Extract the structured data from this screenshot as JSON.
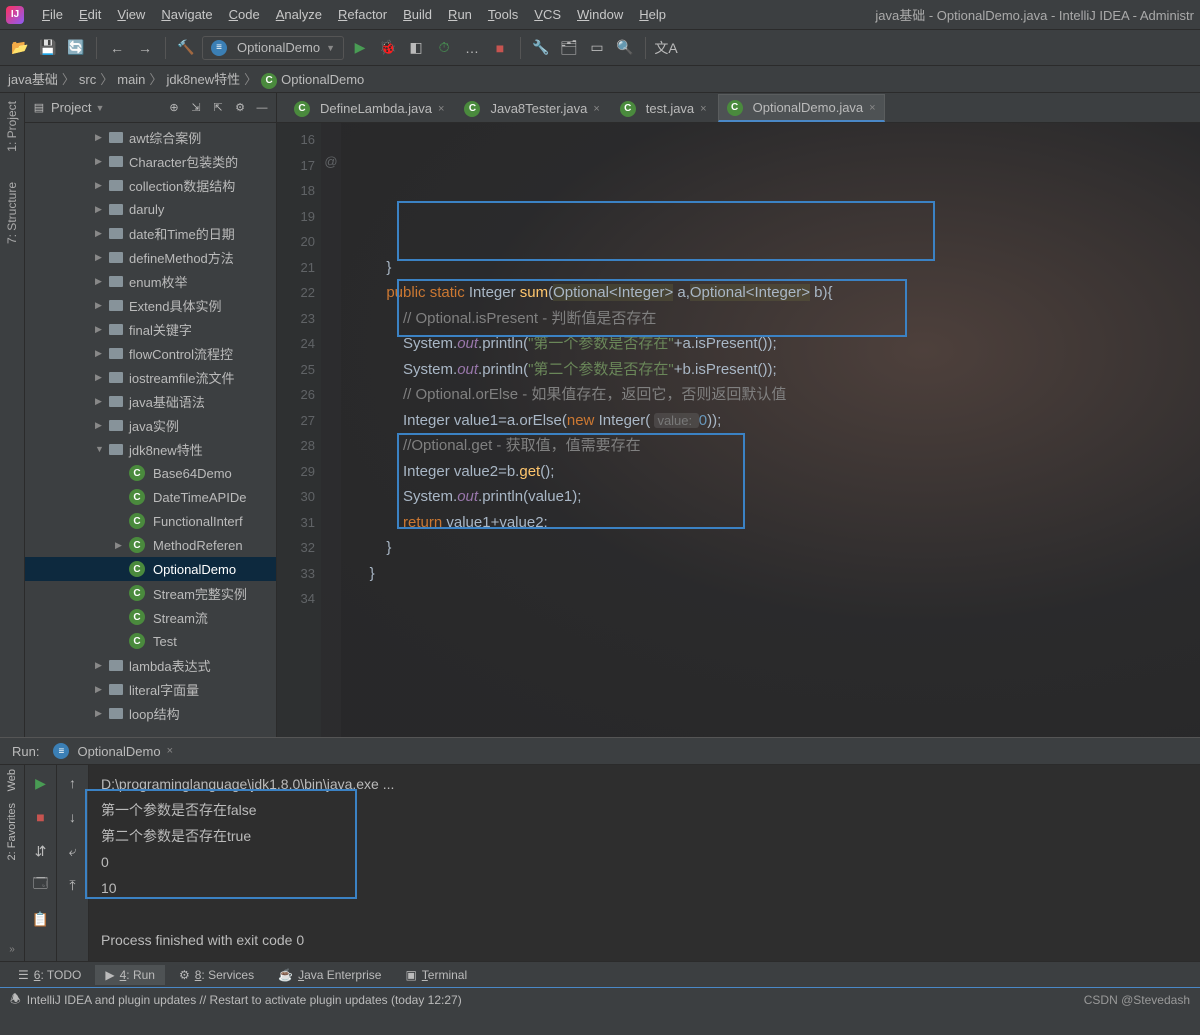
{
  "title": "java基础 - OptionalDemo.java - IntelliJ IDEA - Administr",
  "menus": [
    "File",
    "Edit",
    "View",
    "Navigate",
    "Code",
    "Analyze",
    "Refactor",
    "Build",
    "Run",
    "Tools",
    "VCS",
    "Window",
    "Help"
  ],
  "run_config": "OptionalDemo",
  "breadcrumb": [
    "java基础",
    "src",
    "main",
    "jdk8new特性",
    "OptionalDemo"
  ],
  "project_label": "Project",
  "left_tabs": [
    "1: Project",
    "7: Structure"
  ],
  "tree": [
    {
      "d": 1,
      "a": "▶",
      "i": "f",
      "t": "awt综合案例"
    },
    {
      "d": 1,
      "a": "▶",
      "i": "f",
      "t": "Character包装类的"
    },
    {
      "d": 1,
      "a": "▶",
      "i": "f",
      "t": "collection数据结构"
    },
    {
      "d": 1,
      "a": "▶",
      "i": "f",
      "t": "daruly"
    },
    {
      "d": 1,
      "a": "▶",
      "i": "f",
      "t": "date和Time的日期"
    },
    {
      "d": 1,
      "a": "▶",
      "i": "f",
      "t": "defineMethod方法"
    },
    {
      "d": 1,
      "a": "▶",
      "i": "f",
      "t": "enum枚举"
    },
    {
      "d": 1,
      "a": "▶",
      "i": "f",
      "t": "Extend具体实例"
    },
    {
      "d": 1,
      "a": "▶",
      "i": "f",
      "t": "final关键字"
    },
    {
      "d": 1,
      "a": "▶",
      "i": "f",
      "t": "flowControl流程控"
    },
    {
      "d": 1,
      "a": "▶",
      "i": "f",
      "t": "iostreamfile流文件"
    },
    {
      "d": 1,
      "a": "▶",
      "i": "f",
      "t": "java基础语法"
    },
    {
      "d": 1,
      "a": "▶",
      "i": "f",
      "t": "java实例"
    },
    {
      "d": 1,
      "a": "▼",
      "i": "f",
      "t": "jdk8new特性"
    },
    {
      "d": 2,
      "a": " ",
      "i": "c",
      "t": "Base64Demo"
    },
    {
      "d": 2,
      "a": " ",
      "i": "c",
      "t": "DateTimeAPIDe"
    },
    {
      "d": 2,
      "a": " ",
      "i": "c",
      "t": "FunctionalInterf"
    },
    {
      "d": 2,
      "a": "▶",
      "i": "c",
      "t": "MethodReferen"
    },
    {
      "d": 2,
      "a": " ",
      "i": "c",
      "t": "OptionalDemo",
      "sel": true
    },
    {
      "d": 2,
      "a": " ",
      "i": "c",
      "t": "Stream完整实例"
    },
    {
      "d": 2,
      "a": " ",
      "i": "c",
      "t": "Stream流"
    },
    {
      "d": 2,
      "a": " ",
      "i": "c",
      "t": "Test"
    },
    {
      "d": 1,
      "a": "▶",
      "i": "f",
      "t": "lambda表达式"
    },
    {
      "d": 1,
      "a": "▶",
      "i": "f",
      "t": "literal字面量"
    },
    {
      "d": 1,
      "a": "▶",
      "i": "f",
      "t": "loop结构"
    }
  ],
  "editor_tabs": [
    {
      "label": "DefineLambda.java",
      "active": false
    },
    {
      "label": "Java8Tester.java",
      "active": false
    },
    {
      "label": "test.java",
      "active": false
    },
    {
      "label": "OptionalDemo.java",
      "active": true
    }
  ],
  "line_start": 16,
  "line_end": 34,
  "code_lines": [
    "        }",
    "        <kw>public static</kw> Integer <mth>sum</mth>(<ph>Optional&lt;Integer&gt;</ph> a,<ph>Optional&lt;Integer&gt;</ph> b){",
    "",
    "            <cm>// Optional.isPresent - 判断值是否存在</cm>",
    "            System.<fld>out</fld>.println(<str>\"第一个参数是否存在\"</str>+a.isPresent());",
    "            System.<fld>out</fld>.println(<str>\"第二个参数是否存在\"</str>+b.isPresent());",
    "",
    "            <cm>// Optional.orElse - 如果值存在，返回它，否则返回默认值</cm>",
    "            Integer value1=a.orElse(<kw>new</kw> Integer( <hint>value: </hint><num>0</num>));",
    "",
    "            <cm>//Optional.get - 获取值，值需要存在</cm>",
    "            Integer value2=b.<mth>get</mth>();",
    "",
    "            System.<fld>out</fld>.println(value1);",
    "",
    "            <kw>return</kw> value1+value2;",
    "        }",
    "",
    "    }"
  ],
  "gutter_marker_line": 17,
  "gutter_marker": "@",
  "run_tab_label": "OptionalDemo",
  "run_label": "Run:",
  "console": [
    "D:\\programinglanguage\\jdk1.8.0\\bin\\java.exe ...",
    "第一个参数是否存在false",
    "第二个参数是否存在true",
    "0",
    "10",
    "",
    "Process finished with exit code 0"
  ],
  "left_tabs_bottom": [
    "Web",
    "2: Favorites"
  ],
  "bottom_tabs": [
    {
      "icon": "☰",
      "label": "6: TODO"
    },
    {
      "icon": "▶",
      "label": "4: Run",
      "active": true
    },
    {
      "icon": "⚙",
      "label": "8: Services"
    },
    {
      "icon": "☕",
      "label": "Java Enterprise"
    },
    {
      "icon": "▣",
      "label": "Terminal"
    }
  ],
  "status": "IntelliJ IDEA and plugin updates // Restart to activate plugin updates (today 12:27)",
  "watermark": "CSDN @Stevedash"
}
